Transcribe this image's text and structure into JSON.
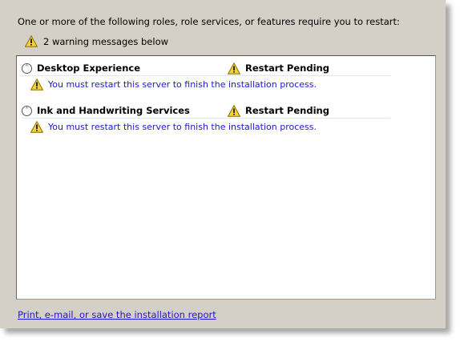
{
  "intro_text": "One or more of the following roles, role services, or features require you to restart:",
  "summary": {
    "icon": "warning-icon",
    "text": "2 warning messages below"
  },
  "features": [
    {
      "name": "Desktop Experience",
      "status": "Restart Pending",
      "message": "You must restart this server to finish the installation process."
    },
    {
      "name": "Ink and Handwriting Services",
      "status": "Restart Pending",
      "message": "You must restart this server to finish the installation process."
    }
  ],
  "report_link": "Print, e-mail, or save the installation report",
  "colors": {
    "link": "#1a1ad0",
    "background": "#d4d0c8",
    "warning": "#f5d33c"
  }
}
